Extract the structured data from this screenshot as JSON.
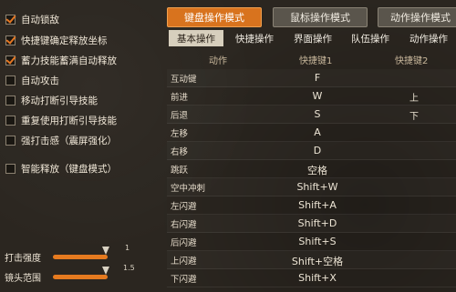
{
  "left_panel": {
    "options": [
      {
        "label": "自动锁敌",
        "checked": true
      },
      {
        "label": "快捷键确定释放坐标",
        "checked": true
      },
      {
        "label": "蓄力技能蓄满自动释放",
        "checked": true
      },
      {
        "label": "自动攻击",
        "checked": false
      },
      {
        "label": "移动打断引导技能",
        "checked": false
      },
      {
        "label": "重复使用打断引导技能",
        "checked": false
      },
      {
        "label": "强打击感（震屏强化）",
        "checked": false
      },
      {
        "label": "智能释放（键盘模式）",
        "checked": false
      }
    ],
    "sliders": [
      {
        "label": "打击强度",
        "value": "1",
        "fill": 1.0
      },
      {
        "label": "镜头范围",
        "value": "1.5",
        "fill": 1.0
      }
    ]
  },
  "mode_buttons": [
    {
      "label": "键盘操作模式",
      "active": true
    },
    {
      "label": "鼠标操作模式",
      "active": false
    },
    {
      "label": "动作操作模式",
      "active": false
    }
  ],
  "tabs": [
    {
      "label": "基本操作",
      "active": true
    },
    {
      "label": "快捷操作",
      "active": false
    },
    {
      "label": "界面操作",
      "active": false
    },
    {
      "label": "队伍操作",
      "active": false
    },
    {
      "label": "动作操作",
      "active": false
    }
  ],
  "table": {
    "headers": {
      "action": "动作",
      "key1": "快捷键1",
      "key2": "快捷键2"
    },
    "rows": [
      {
        "action": "互动键",
        "key1": "F",
        "key2": ""
      },
      {
        "action": "前进",
        "key1": "W",
        "key2": "上"
      },
      {
        "action": "后退",
        "key1": "S",
        "key2": "下"
      },
      {
        "action": "左移",
        "key1": "A",
        "key2": ""
      },
      {
        "action": "右移",
        "key1": "D",
        "key2": ""
      },
      {
        "action": "跳跃",
        "key1": "空格",
        "key2": ""
      },
      {
        "action": "空中冲刺",
        "key1": "Shift+W",
        "key2": ""
      },
      {
        "action": "左闪避",
        "key1": "Shift+A",
        "key2": ""
      },
      {
        "action": "右闪避",
        "key1": "Shift+D",
        "key2": ""
      },
      {
        "action": "后闪避",
        "key1": "Shift+S",
        "key2": ""
      },
      {
        "action": "上闪避",
        "key1": "Shift+空格",
        "key2": ""
      },
      {
        "action": "下闪避",
        "key1": "Shift+X",
        "key2": ""
      }
    ]
  },
  "colors": {
    "accent": "#d8731e",
    "slider": "#e57a1f",
    "check": "#e57722"
  }
}
